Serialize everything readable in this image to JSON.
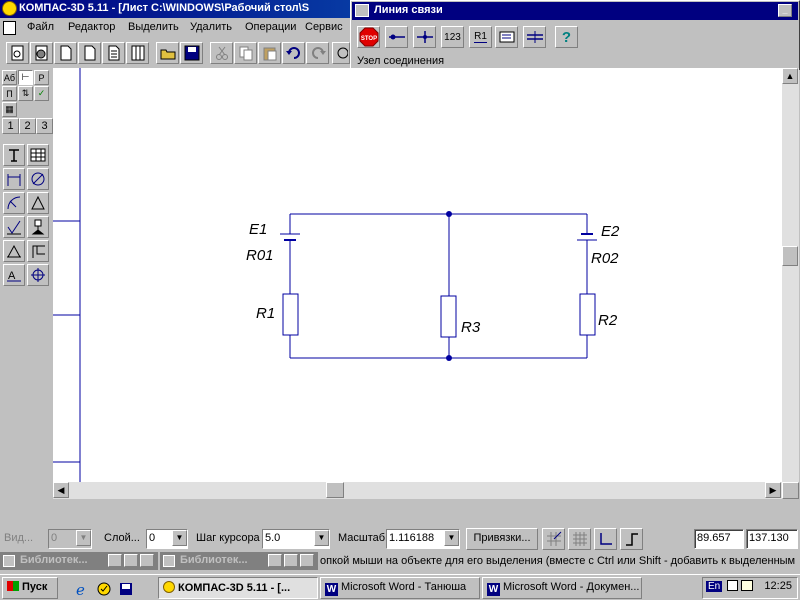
{
  "window": {
    "title": "КОМПАС-3D 5.11 - [Лист C:\\WINDOWS\\Рабочий стол\\S",
    "menu": [
      "Файл",
      "Редактор",
      "Выделить",
      "Удалить",
      "Операции",
      "Сервис"
    ]
  },
  "link_panel": {
    "title": "Линия связи",
    "status": "Узел соединения",
    "buttons": [
      "STOP",
      "123",
      "R1",
      "?"
    ]
  },
  "left_panel": {
    "tabs": [
      "1",
      "2",
      "3"
    ]
  },
  "schematic": {
    "labels": [
      "E1",
      "R01",
      "R1",
      "R3",
      "E2",
      "R02",
      "R2"
    ]
  },
  "controls": {
    "view_label": "Вид...",
    "view_value": "0",
    "layer_label": "Слой...",
    "layer_value": "0",
    "step_label": "Шаг курсора",
    "step_value": "5.0",
    "scale_label": "Масштаб",
    "scale_value": "1.116188",
    "snap_button": "Привязки...",
    "coord_x": "89.657",
    "coord_y": "137.130"
  },
  "docked_windows": [
    {
      "title": "Библиотек..."
    },
    {
      "title": "Библиотек..."
    }
  ],
  "hint": "опкой мыши на объекте для его выделения (вместе с Ctrl или Shift - добавить к выделенным",
  "taskbar": {
    "start": "Пуск",
    "tasks": [
      "КОМПАС-3D 5.11 - [...",
      "Microsoft Word - Танюша",
      "Microsoft Word - Докумен..."
    ],
    "lang": "En",
    "clock": "12:25"
  },
  "colors": {
    "titlebar": "#000080",
    "schematic": "#0000a0",
    "workspace": "#c0c0c0"
  }
}
